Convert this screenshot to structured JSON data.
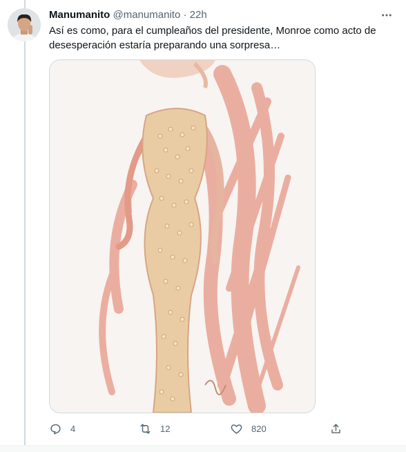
{
  "tweet": {
    "author_name": "Manumanito",
    "author_handle": "@manumanito",
    "separator": "·",
    "time": "22h",
    "text": "Así es como, para el cumpleaños del presidente, Monroe como acto de desesperación estaría preparando una sorpresa…",
    "media_icon": "fashion-sketch-image"
  },
  "actions": {
    "reply_count": "4",
    "retweet_count": "12",
    "like_count": "820",
    "reply_icon": "reply-icon",
    "retweet_icon": "retweet-icon",
    "like_icon": "heart-icon",
    "share_icon": "share-icon"
  },
  "colors": {
    "text": "#0f1419",
    "secondary": "#536471",
    "border": "#cfd9de",
    "sketch_stroke": "#e59a8a",
    "dress_gold": "#e6c79b"
  }
}
